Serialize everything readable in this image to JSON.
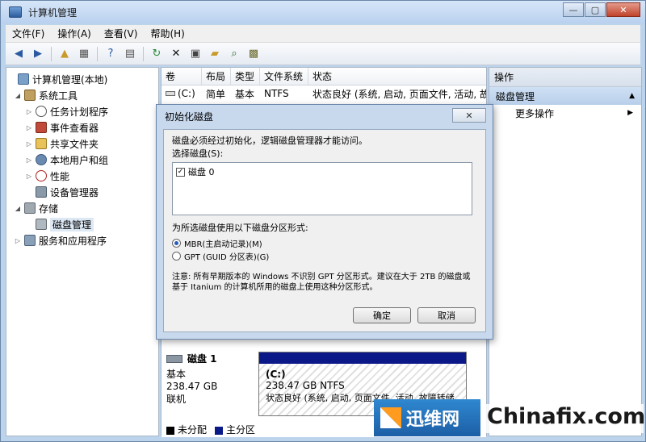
{
  "window": {
    "title": "计算机管理",
    "btn_min": "—",
    "btn_max": "▢",
    "btn_close": "✕"
  },
  "menu": [
    "文件(F)",
    "操作(A)",
    "查看(V)",
    "帮助(H)"
  ],
  "tree": {
    "root": "计算机管理(本地)",
    "system_tools": "系统工具",
    "task_scheduler": "任务计划程序",
    "event_viewer": "事件查看器",
    "shared_folders": "共享文件夹",
    "local_users": "本地用户和组",
    "performance": "性能",
    "device_manager": "设备管理器",
    "storage": "存储",
    "disk_management": "磁盘管理",
    "services_apps": "服务和应用程序"
  },
  "list": {
    "headers": [
      "卷",
      "布局",
      "类型",
      "文件系统",
      "状态"
    ],
    "rows": [
      {
        "volume": "(C:)",
        "layout": "简单",
        "type": "基本",
        "fs": "NTFS",
        "status": "状态良好 (系统, 启动, 页面文件, 活动, 故"
      }
    ]
  },
  "disk_map": {
    "disk_name": "磁盘 1",
    "disk_type": "基本",
    "disk_size": "238.47 GB",
    "disk_state": "联机",
    "partition_label": "(C:)",
    "partition_size": "238.47 GB NTFS",
    "partition_status": "状态良好 (系统, 启动, 页面文件, 活动, 故障转储",
    "legend": [
      {
        "label": "未分配",
        "color": "#000000"
      },
      {
        "label": "主分区",
        "color": "#0a1888"
      }
    ]
  },
  "actions": {
    "header": "操作",
    "selected": "磁盘管理",
    "more": "更多操作"
  },
  "dialog": {
    "title": "初始化磁盘",
    "close": "✕",
    "intro": "磁盘必须经过初始化，逻辑磁盘管理器才能访问。",
    "select_label": "选择磁盘(S):",
    "disk_item": "磁盘 0",
    "style_label": "为所选磁盘使用以下磁盘分区形式:",
    "option_mbr": "MBR(主启动记录)(M)",
    "option_gpt": "GPT (GUID 分区表)(G)",
    "note": "注意: 所有早期版本的 Windows 不识别 GPT 分区形式。建议在大于 2TB 的磁盘或基于 Itanium 的计算机所用的磁盘上使用这种分区形式。",
    "ok": "确定",
    "cancel": "取消"
  },
  "watermark": {
    "cn": "迅维网",
    "en": "Chinafix.com"
  }
}
